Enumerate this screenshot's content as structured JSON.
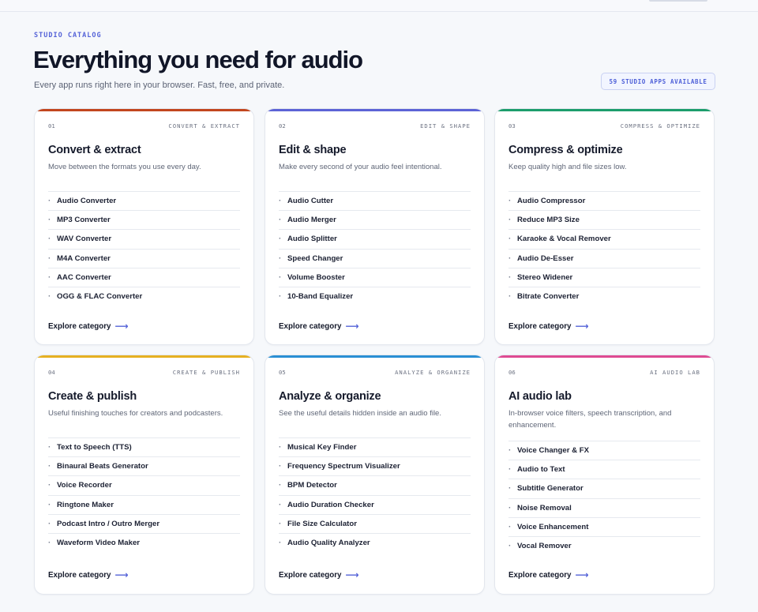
{
  "header": {
    "eyebrow": "STUDIO CATALOG",
    "title": "Everything you need for audio",
    "subtitle": "Every app runs right here in your browser. Fast, free, and private.",
    "apps_badge": "59 STUDIO APPS AVAILABLE"
  },
  "cards": [
    {
      "number": "01",
      "tag": "CONVERT & EXTRACT",
      "title": "Convert & extract",
      "description": "Move between the formats you use every day.",
      "accent": "#c2461f",
      "items": [
        "Audio Converter",
        "MP3 Converter",
        "WAV Converter",
        "M4A Converter",
        "AAC Converter",
        "OGG & FLAC Converter"
      ],
      "link": "Explore category"
    },
    {
      "number": "02",
      "tag": "EDIT & SHAPE",
      "title": "Edit & shape",
      "description": "Make every second of your audio feel intentional.",
      "accent": "#5c63d6",
      "items": [
        "Audio Cutter",
        "Audio Merger",
        "Audio Splitter",
        "Speed Changer",
        "Volume Booster",
        "10-Band Equalizer"
      ],
      "link": "Explore category"
    },
    {
      "number": "03",
      "tag": "COMPRESS & OPTIMIZE",
      "title": "Compress & optimize",
      "description": "Keep quality high and file sizes low.",
      "accent": "#1c9d6c",
      "items": [
        "Audio Compressor",
        "Reduce MP3 Size",
        "Karaoke & Vocal Remover",
        "Audio De-Esser",
        "Stereo Widener",
        "Bitrate Converter"
      ],
      "link": "Explore category"
    },
    {
      "number": "04",
      "tag": "CREATE & PUBLISH",
      "title": "Create & publish",
      "description": "Useful finishing touches for creators and podcasters.",
      "accent": "#e6b021",
      "items": [
        "Text to Speech (TTS)",
        "Binaural Beats Generator",
        "Voice Recorder",
        "Ringtone Maker",
        "Podcast Intro / Outro Merger",
        "Waveform Video Maker"
      ],
      "link": "Explore category"
    },
    {
      "number": "05",
      "tag": "ANALYZE & ORGANIZE",
      "title": "Analyze & organize",
      "description": "See the useful details hidden inside an audio file.",
      "accent": "#2a8fd4",
      "items": [
        "Musical Key Finder",
        "Frequency Spectrum Visualizer",
        "BPM Detector",
        "Audio Duration Checker",
        "File Size Calculator",
        "Audio Quality Analyzer"
      ],
      "link": "Explore category"
    },
    {
      "number": "06",
      "tag": "AI AUDIO LAB",
      "title": "AI audio lab",
      "description": "In-browser voice filters, speech transcription, and enhancement.",
      "accent": "#de4b92",
      "items": [
        "Voice Changer & FX",
        "Audio to Text",
        "Subtitle Generator",
        "Noise Removal",
        "Voice Enhancement",
        "Vocal Remover"
      ],
      "link": "Explore category"
    }
  ]
}
